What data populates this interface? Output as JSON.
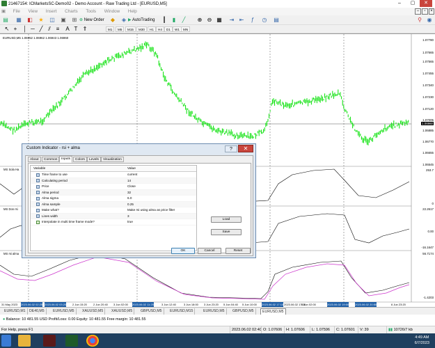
{
  "window": {
    "title": "21467154: ICMarketsSC-Demo02 - Demo Account - Raw Trading Ltd - [EURUSD,M5]"
  },
  "menu": [
    "File",
    "View",
    "Insert",
    "Charts",
    "Tools",
    "Window",
    "Help"
  ],
  "toolbar": {
    "new_order": "New Order",
    "autotrading": "AutoTrading"
  },
  "timeframes": [
    "M1",
    "M5",
    "M15",
    "M30",
    "H1",
    "H4",
    "D1",
    "W1",
    "MN"
  ],
  "chart": {
    "header": "EURUSD,M5  1.06952 1.06962 1.06943 1.06960",
    "price_labels": [
      "1.07780",
      "1.07665",
      "1.07565",
      "1.07455",
      "1.07340",
      "1.07230",
      "1.07120",
      "1.07005",
      "1.06960",
      "1.06885",
      "1.06770",
      "1.06655",
      "1.06545"
    ],
    "current_price": "1.06960",
    "pane1": {
      "label": "MS Sola Ha",
      "top": "253.7",
      "bottom": "0"
    },
    "pane2": {
      "label": "MS Don rsi",
      "top": "22.2617",
      "mid": "0.00",
      "bottom": "-16.1647"
    },
    "pane3": {
      "label": "MS rsi alma",
      "top": "56.7174",
      "bottom": "-1.4203"
    },
    "time_labels": [
      "31 May 2023",
      "2023.06.02 02:25",
      "2023.06.02 03:20",
      "2 Jun 15:20",
      "2 Jun 20:40",
      "3 Jun 02:00",
      "2023.06.02 11:25",
      "3 Jun 12:40",
      "3 Jun 18:00",
      "3 Jun 23:20",
      "5 Jun 04:40",
      "5 Jun 10:00",
      "2023.06.02 17:10",
      "2023.06.02 17:30",
      "6 Jun 02:00",
      "2023.06.02 19:00",
      "2023.06.02 20:50",
      "6 Jun 23:20"
    ]
  },
  "tabs": [
    "EURUSD,M1",
    "DE40,M5",
    "EURUSD,M5",
    "XAUUSD,M5",
    "XAUUSD,M5",
    "GBPUSD,M5",
    "EURUSD,M15",
    "EURUSD,M5",
    "GBPUSD,M5",
    "EURUSD,M5"
  ],
  "active_tab": "EURUSD,M5",
  "account": "Balance: 10 481.55 USD  Profit/Loss: 0.00  Equity: 10 481.55  Free margin: 10 481.55",
  "status": {
    "help": "For Help, press F1",
    "date": "2023.06.02 02:40",
    "open": "O: 1.07606",
    "high": "H: 1.07606",
    "low": "L: 1.07596",
    "close": "C: 1.07601",
    "volume": "V: 39",
    "traffic": "10726/7 kb"
  },
  "clock": {
    "time": "4:49 AM",
    "date": "6/7/2023"
  },
  "dialog": {
    "title": "Custom Indicator - rsi + alma",
    "tabs": [
      "About",
      "Common",
      "Inputs",
      "Colors",
      "Levels",
      "Visualization"
    ],
    "active_tab": "Inputs",
    "columns": [
      "Variable",
      "Value"
    ],
    "rows": [
      {
        "name": "Time frame to use",
        "value": "current"
      },
      {
        "name": "Calculating period",
        "value": "14"
      },
      {
        "name": "Price",
        "value": "Close"
      },
      {
        "name": "Alma period",
        "value": "32"
      },
      {
        "name": "Alma sigma",
        "value": "6.0"
      },
      {
        "name": "Alma sample",
        "value": "0.25"
      },
      {
        "name": "Make what?",
        "value": "Make rsi using alma as price filter"
      },
      {
        "name": "Lines width",
        "value": "3"
      },
      {
        "name": "Interpolate in multi time frame mode?",
        "value": "true"
      }
    ],
    "load": "Load",
    "save": "Save",
    "ok": "OK",
    "cancel": "Cancel",
    "reset": "Reset"
  }
}
